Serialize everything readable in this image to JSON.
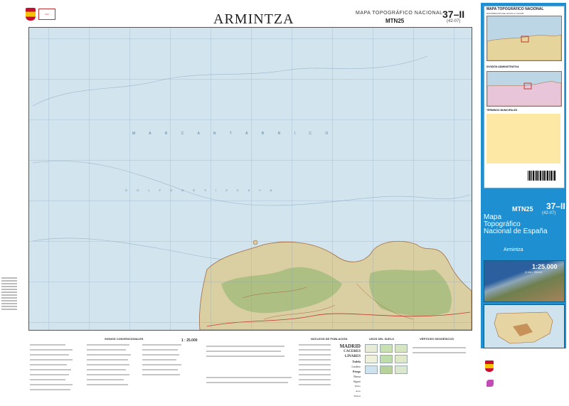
{
  "header": {
    "title": "ARMINTZA",
    "series_title": "MAPA TOPOGRÁFICO NACIONAL",
    "series_code": "MTN25",
    "sheet_number": "37–II",
    "sheet_subnumber": "(42-07)"
  },
  "map": {
    "sea_name": "M A R   C A N T Á B R I C O",
    "gulf_name": "G O L F O   D E   V I Z C A Y A",
    "colors": {
      "sea": "#d2e4ee",
      "land": "#d9cfa3",
      "forest": "#9fb97a",
      "contour": "#a36b3c",
      "grid": "#6e8fb0"
    }
  },
  "legend": {
    "signos_title": "SIGNOS CONVENCIONALES",
    "scale_text": "1 : 25.000",
    "nucleos_title": "NÚCLEOS DE POBLACIÓN",
    "usos_title": "USOS DEL SUELO",
    "vertices_title": "VÉRTICES GEODÉSICOS",
    "population_examples": [
      "MADRID",
      "CACERES",
      "LINARES",
      "Tudela",
      "Lardero",
      "Priego",
      "Baeza",
      "Algete",
      "Pedro",
      "Areo",
      "Fumos"
    ]
  },
  "side_panel": {
    "index_title": "MAPA TOPOGRÁFICO NACIONAL",
    "index_subtitle": "DISTRIBUCIÓN DE HOJAS A 1:50.000",
    "division_title": "DIVISIÓN ADMINISTRATIVA",
    "terminos_title": "TÉRMINOS MUNICIPALES",
    "mtn25": "MTN25",
    "sheet_number": "37–II",
    "sheet_subnumber": "(42-07)",
    "mapa_lines": [
      "Mapa",
      "Topográfico",
      "Nacional de España"
    ],
    "place": "Armintza",
    "scale_big": "1:25.000",
    "scale_small": "(1 cm = 250 m)"
  }
}
